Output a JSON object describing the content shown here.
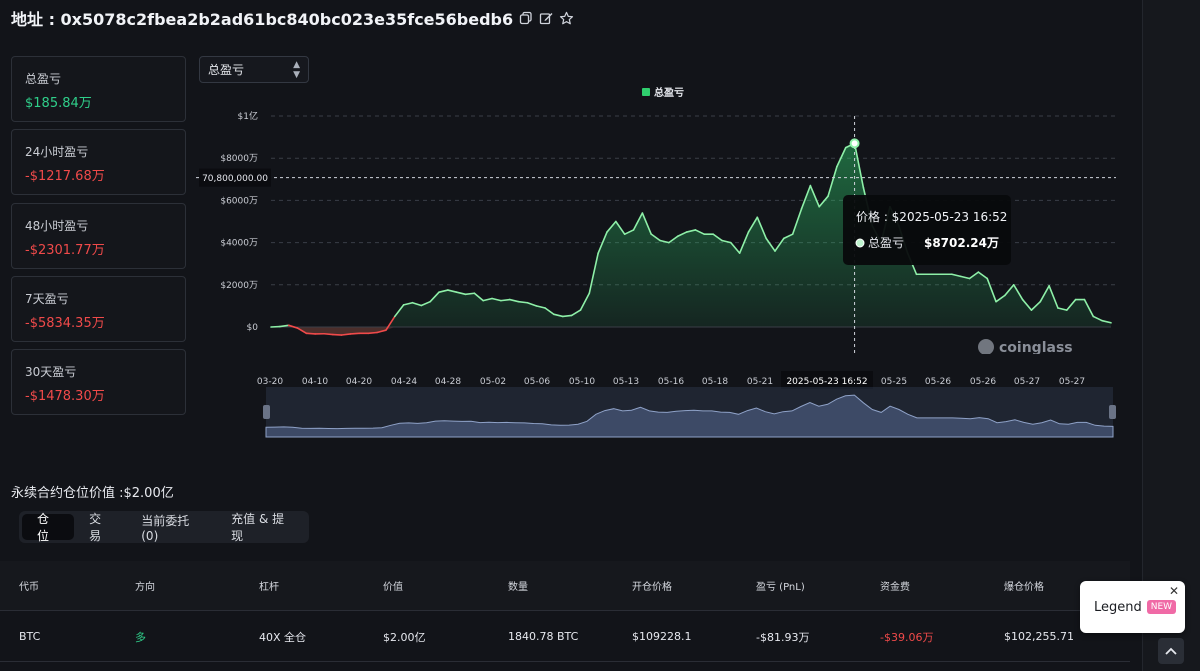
{
  "header": {
    "address_label": "地址 : 0x5078c2fbea2b2ad61bc840bc023e35fce56bedb6",
    "copy_icon": "copy-icon",
    "edit_icon": "edit-icon",
    "star_icon": "star-icon"
  },
  "stats": [
    {
      "label": "总盈亏",
      "value": "$185.84万",
      "tone": "pos"
    },
    {
      "label": "24小时盈亏",
      "value": "-$1217.68万",
      "tone": "neg"
    },
    {
      "label": "48小时盈亏",
      "value": "-$2301.77万",
      "tone": "neg"
    },
    {
      "label": "7天盈亏",
      "value": "-$5834.35万",
      "tone": "neg"
    },
    {
      "label": "30天盈亏",
      "value": "-$1478.30万",
      "tone": "neg"
    }
  ],
  "selector": {
    "value": "总盈亏"
  },
  "chart_data": {
    "type": "area",
    "legend": [
      "总盈亏"
    ],
    "series_color": "#2fcf6e",
    "negative_color": "#f04a4a",
    "y_ticks": [
      "$1亿",
      "$8000万",
      "$6000万",
      "$4000万",
      "$2000万",
      "$0"
    ],
    "y_tick_values": [
      100000000,
      80000000,
      60000000,
      40000000,
      20000000,
      0
    ],
    "ylim": [
      -10000000,
      100000000
    ],
    "x_ticks": [
      "03-20",
      "04-10",
      "04-20",
      "04-24",
      "04-28",
      "05-02",
      "05-06",
      "05-10",
      "05-13",
      "05-16",
      "05-18",
      "05-21",
      "2025-05-23 16:52",
      "05-25",
      "05-26",
      "05-26",
      "05-27",
      "05-27"
    ],
    "crosshair_y_label": "70,800,000.00",
    "crosshair_y_value": 70800000,
    "tooltip": {
      "title": "价格 : $2025-05-23 16:52",
      "series": "总盈亏",
      "value": "$8702.24万"
    },
    "watermark": "coinglass",
    "values": [
      0,
      0.2,
      0.8,
      -0.5,
      -3.0,
      -3.3,
      -3.2,
      -3.6,
      -3.8,
      -3.3,
      -3.0,
      -3.0,
      -2.6,
      -1.5,
      5.0,
      10.5,
      11.5,
      10.2,
      12.0,
      16.5,
      17.5,
      16.5,
      15.5,
      16.0,
      12.5,
      13.5,
      12.5,
      13.0,
      12.0,
      11.5,
      10.0,
      9.0,
      6.0,
      5.0,
      5.5,
      8.0,
      16.0,
      35.0,
      45.0,
      50.0,
      44.0,
      46.0,
      54.0,
      44.0,
      41.0,
      40.0,
      43.0,
      45.0,
      46.0,
      44.0,
      44.0,
      41.0,
      40.0,
      35.0,
      45.0,
      52.0,
      42.0,
      36.0,
      42.0,
      44.0,
      56.0,
      67.0,
      57.0,
      62.0,
      76.0,
      85.0,
      87.02,
      66.0,
      48.0,
      40.0,
      57.0,
      48.0,
      35.0,
      25.0,
      25.0,
      25.0,
      25.0,
      25.0,
      24.0,
      23.0,
      26.0,
      23.0,
      12.0,
      15.0,
      20.0,
      13.0,
      8.0,
      12.0,
      19.5,
      9.0,
      8.0,
      13.0,
      13.0,
      5.0,
      3.0,
      2.0
    ],
    "value_unit": "百万美元"
  },
  "section": {
    "title": "永续合约仓位价值 :$2.00亿"
  },
  "tabs": [
    {
      "label": "仓位",
      "active": true
    },
    {
      "label": "交易",
      "active": false
    },
    {
      "label": "当前委托(0)",
      "active": false
    },
    {
      "label": "充值 & 提现",
      "active": false
    }
  ],
  "table": {
    "headers": [
      "代币",
      "方向",
      "杠杆",
      "价值",
      "数量",
      "开仓价格",
      "盈亏 (PnL)",
      "资金费",
      "爆仓价格"
    ],
    "rows": [
      [
        "BTC",
        "多",
        "40X 全仓",
        "$2.00亿",
        "1840.78 BTC",
        "$109228.1",
        "-$81.93万",
        "-$39.06万",
        "$102,255.71"
      ]
    ]
  },
  "legend_button": {
    "label": "Legend",
    "badge": "NEW",
    "close_icon": "close-icon"
  },
  "scroll_top_icon": "chevron-up-icon"
}
